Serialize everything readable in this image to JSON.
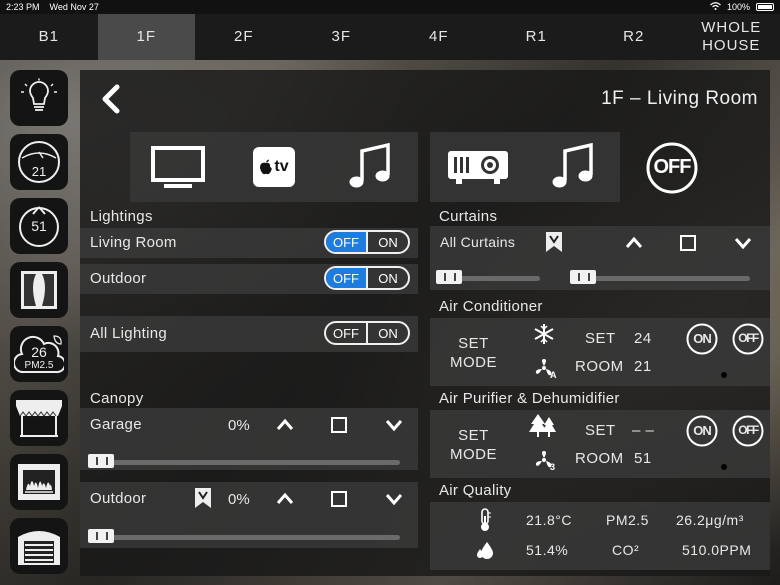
{
  "statusbar": {
    "time": "2:23 PM",
    "date": "Wed Nov 27",
    "battery": "100%"
  },
  "floors": [
    {
      "label": "B1"
    },
    {
      "label": "1F"
    },
    {
      "label": "2F"
    },
    {
      "label": "3F"
    },
    {
      "label": "4F"
    },
    {
      "label": "R1"
    },
    {
      "label": "R2"
    },
    {
      "label": "WHOLE\nHOUSE"
    }
  ],
  "active_floor": "1F",
  "sidebar": [
    {
      "name": "lighting-icon"
    },
    {
      "name": "thermostat-icon",
      "value": "21"
    },
    {
      "name": "humidity-icon",
      "value": "51"
    },
    {
      "name": "curtain-icon"
    },
    {
      "name": "air-quality-icon",
      "value": "26",
      "sub": "PM2.5"
    },
    {
      "name": "canopy-icon"
    },
    {
      "name": "fireplace-icon"
    },
    {
      "name": "garage-icon"
    }
  ],
  "header": {
    "title": "1F – Living Room"
  },
  "scenes": {
    "appletv_label": "tv",
    "off_label": "OFF"
  },
  "lightings": {
    "title": "Lightings",
    "items": [
      {
        "label": "Living Room",
        "off": "OFF",
        "on": "ON"
      },
      {
        "label": "Outdoor",
        "off": "OFF",
        "on": "ON"
      }
    ],
    "all": {
      "label": "All Lighting",
      "off": "OFF",
      "on": "ON"
    }
  },
  "canopy": {
    "title": "Canopy",
    "items": [
      {
        "label": "Garage",
        "value": "0%"
      },
      {
        "label": "Outdoor",
        "value": "0%"
      }
    ]
  },
  "curtains": {
    "title": "Curtains",
    "all_label": "All Curtains"
  },
  "air_conditioner": {
    "title": "Air Conditioner",
    "set_mode": "SET\nMODE",
    "set_label": "SET",
    "set_value": "24",
    "room_label": "ROOM",
    "room_value": "21",
    "on": "ON",
    "off": "OFF",
    "fan_mode": "A"
  },
  "air_purifier": {
    "title": "Air Purifier & Dehumidifier",
    "set_mode": "SET\nMODE",
    "set_label": "SET",
    "set_value": "– –",
    "room_label": "ROOM",
    "room_value": "51",
    "on": "ON",
    "off": "OFF",
    "fan_mode": "3"
  },
  "air_quality": {
    "title": "Air Quality",
    "temperature": "21.8°C",
    "pm_label": "PM2.5",
    "pm_value": "26.2μg/m³",
    "humidity": "51.4%",
    "co2_label": "CO²",
    "co2_value": "510.0PPM"
  },
  "colors": {
    "accent": "#1e7be0",
    "panel": "#191919",
    "tab_active": "#4a4a4a"
  }
}
